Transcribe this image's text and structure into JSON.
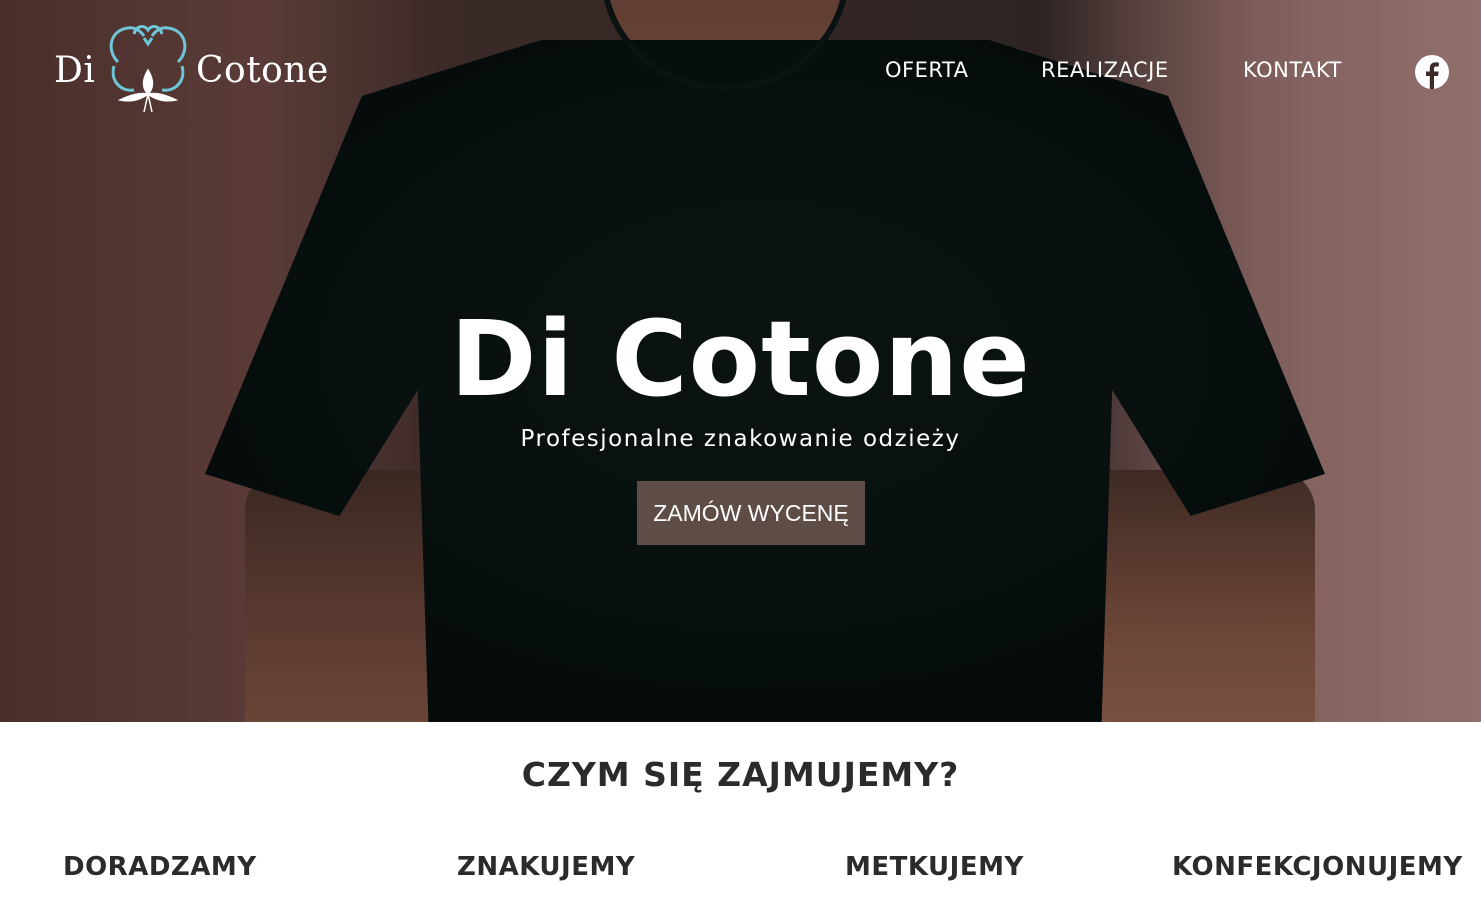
{
  "brand": {
    "logo_left": "Di",
    "logo_right": "Cotone",
    "logo_icon": "cotton-flower-icon",
    "accent_color": "#6ec6d8"
  },
  "nav": {
    "items": [
      {
        "label": "OFERTA"
      },
      {
        "label": "REALIZACJE"
      },
      {
        "label": "KONTAKT"
      }
    ],
    "social_icon": "facebook-icon"
  },
  "hero": {
    "title": "Di Cotone",
    "subtitle": "Profesjonalne znakowanie odzieży",
    "cta_label": "ZAMÓW WYCENĘ",
    "cta_color": "#5e4d46"
  },
  "services": {
    "title": "CZYM SIĘ ZAJMUJEMY?",
    "items": [
      {
        "label": "DORADZAMY"
      },
      {
        "label": "ZNAKUJEMY"
      },
      {
        "label": "METKUJEMY"
      },
      {
        "label": "KONFEKCJONUJEMY"
      }
    ]
  }
}
